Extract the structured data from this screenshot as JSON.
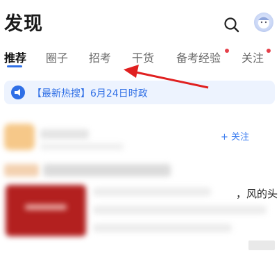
{
  "header": {
    "title": "发现"
  },
  "tabs": [
    {
      "label": "推荐",
      "active": true,
      "has_dot": false
    },
    {
      "label": "圈子",
      "active": false,
      "has_dot": false
    },
    {
      "label": "招考",
      "active": false,
      "has_dot": false
    },
    {
      "label": "干货",
      "active": false,
      "has_dot": false
    },
    {
      "label": "备考经验",
      "active": false,
      "has_dot": true
    },
    {
      "label": "关注",
      "active": false,
      "has_dot": true
    }
  ],
  "banner": {
    "text": "【最新热搜】6月24日时政",
    "icon": "megaphone-icon"
  },
  "feed": {
    "follow_label": "+ 关注",
    "snippet": "，风的头"
  },
  "icons": {
    "search": "search-icon",
    "avatar": "avatar"
  },
  "colors": {
    "accent": "#2f6fe6",
    "badge": "#e5404a",
    "banner_bg": "#edf3fe",
    "arrow": "#e02020"
  }
}
